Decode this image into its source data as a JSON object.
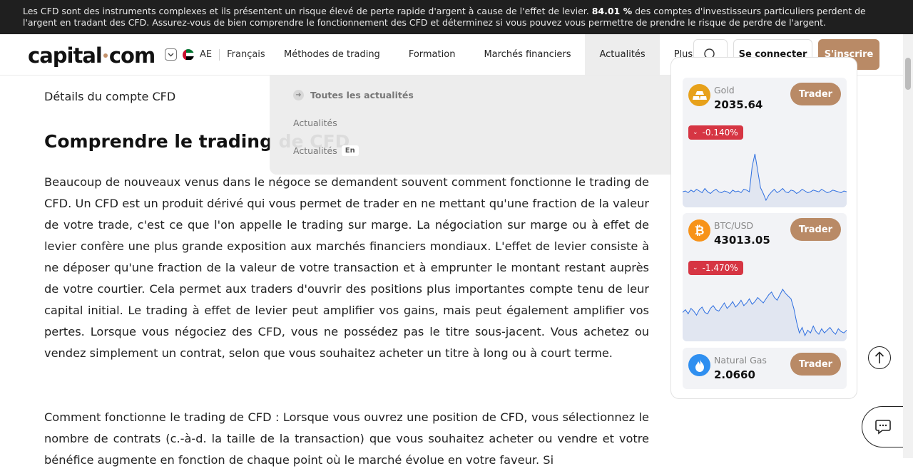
{
  "risk_banner": {
    "text_before": "Les CFD sont des instruments complexes et ils présentent un risque élevé de perte rapide d'argent à cause de l'effet de levier.",
    "percent": "84.01 %",
    "text_after": "des comptes d'investisseurs particuliers perdent de l'argent en tradant des CFD. Assurez-vous de bien comprendre le fonctionnement des CFD et déterminez si vous pouvez vous permettre de prendre le risque de perdre de l'argent."
  },
  "header": {
    "logo": {
      "left": "capital",
      "right": "com"
    },
    "region": "AE",
    "language": "Français",
    "nav": [
      "Méthodes de trading",
      "Formation",
      "Marchés financiers",
      "Actualités",
      "Plus"
    ],
    "active_nav": "Actualités",
    "login_label": "Se connecter",
    "signup_label": "S'inscrire"
  },
  "dropdown": {
    "all_news": "Toutes les actualités",
    "link1": "Actualités",
    "link2": "Actualités",
    "link2_badge": "En"
  },
  "article": {
    "breadcrumb_text": "Détails du compte CFD",
    "heading": "Comprendre le trading de CFD",
    "paragraph1": "Beaucoup de nouveaux venus dans le négoce se demandent souvent comment fonctionne le trading de CFD. Un CFD est un produit dérivé qui vous permet de trader en ne mettant qu'une fraction de la valeur de votre trade, c'est ce que l'on appelle le trading sur marge. La négociation sur marge ou à effet de levier confère une plus grande exposition aux marchés financiers mondiaux. L'effet de levier consiste à ne déposer qu'une fraction de la valeur de votre transaction et à emprunter le montant restant auprès de votre courtier. Cela permet aux traders d'ouvrir des positions plus importantes compte tenu de leur capital initial. Le trading à effet de levier peut amplifier vos gains, mais peut également amplifier vos pertes. Lorsque vous négociez des CFD, vous ne possédez pas le titre sous-jacent. Vous achetez ou vendez simplement un contrat, selon que vous souhaitez acheter un titre à long ou à court terme.",
    "paragraph2": "Comment fonctionne le trading de CFD : Lorsque vous ouvrez une position de CFD, vous sélectionnez le nombre de contrats (c.-à-d. la taille de la transaction) que vous souhaitez acheter ou vendre et votre bénéfice augmente en fonction de chaque point où le marché évolue en votre faveur. Si"
  },
  "markets": [
    {
      "name": "Gold",
      "price": "2035.64",
      "change": "-0.140%",
      "trade_label": "Trader",
      "icon": "gold-bars-icon",
      "icon_color": "#e7a11b",
      "spark": [
        30,
        31,
        29,
        32,
        30,
        33,
        31,
        29,
        34,
        30,
        28,
        31,
        33,
        30,
        29,
        31,
        30,
        28,
        32,
        30,
        31,
        29,
        33,
        32,
        30,
        60,
        75,
        55,
        35,
        28,
        20,
        26,
        30,
        33,
        29,
        31,
        34,
        30,
        29,
        32,
        31,
        28,
        30,
        33,
        31,
        29,
        30,
        32,
        31,
        30,
        33,
        31,
        29,
        30,
        32,
        31,
        30,
        29,
        31,
        30
      ]
    },
    {
      "name": "BTC/USD",
      "price": "43013.05",
      "change": "-1.470%",
      "trade_label": "Trader",
      "icon": "bitcoin-icon",
      "icon_color": "#f7931a",
      "spark": [
        45,
        47,
        44,
        48,
        46,
        43,
        47,
        49,
        45,
        44,
        48,
        50,
        47,
        46,
        49,
        52,
        48,
        50,
        53,
        49,
        51,
        54,
        50,
        52,
        55,
        51,
        53,
        56,
        54,
        52,
        55,
        58,
        60,
        56,
        54,
        58,
        62,
        59,
        57,
        55,
        48,
        38,
        30,
        34,
        28,
        32,
        30,
        35,
        31,
        29,
        33,
        30,
        32,
        34,
        31,
        29,
        33,
        31,
        30,
        32
      ]
    },
    {
      "name": "Natural Gas",
      "price": "2.0660",
      "trade_label": "Trader",
      "icon": "flame-icon",
      "icon_color": "#2f8ff0"
    }
  ]
}
